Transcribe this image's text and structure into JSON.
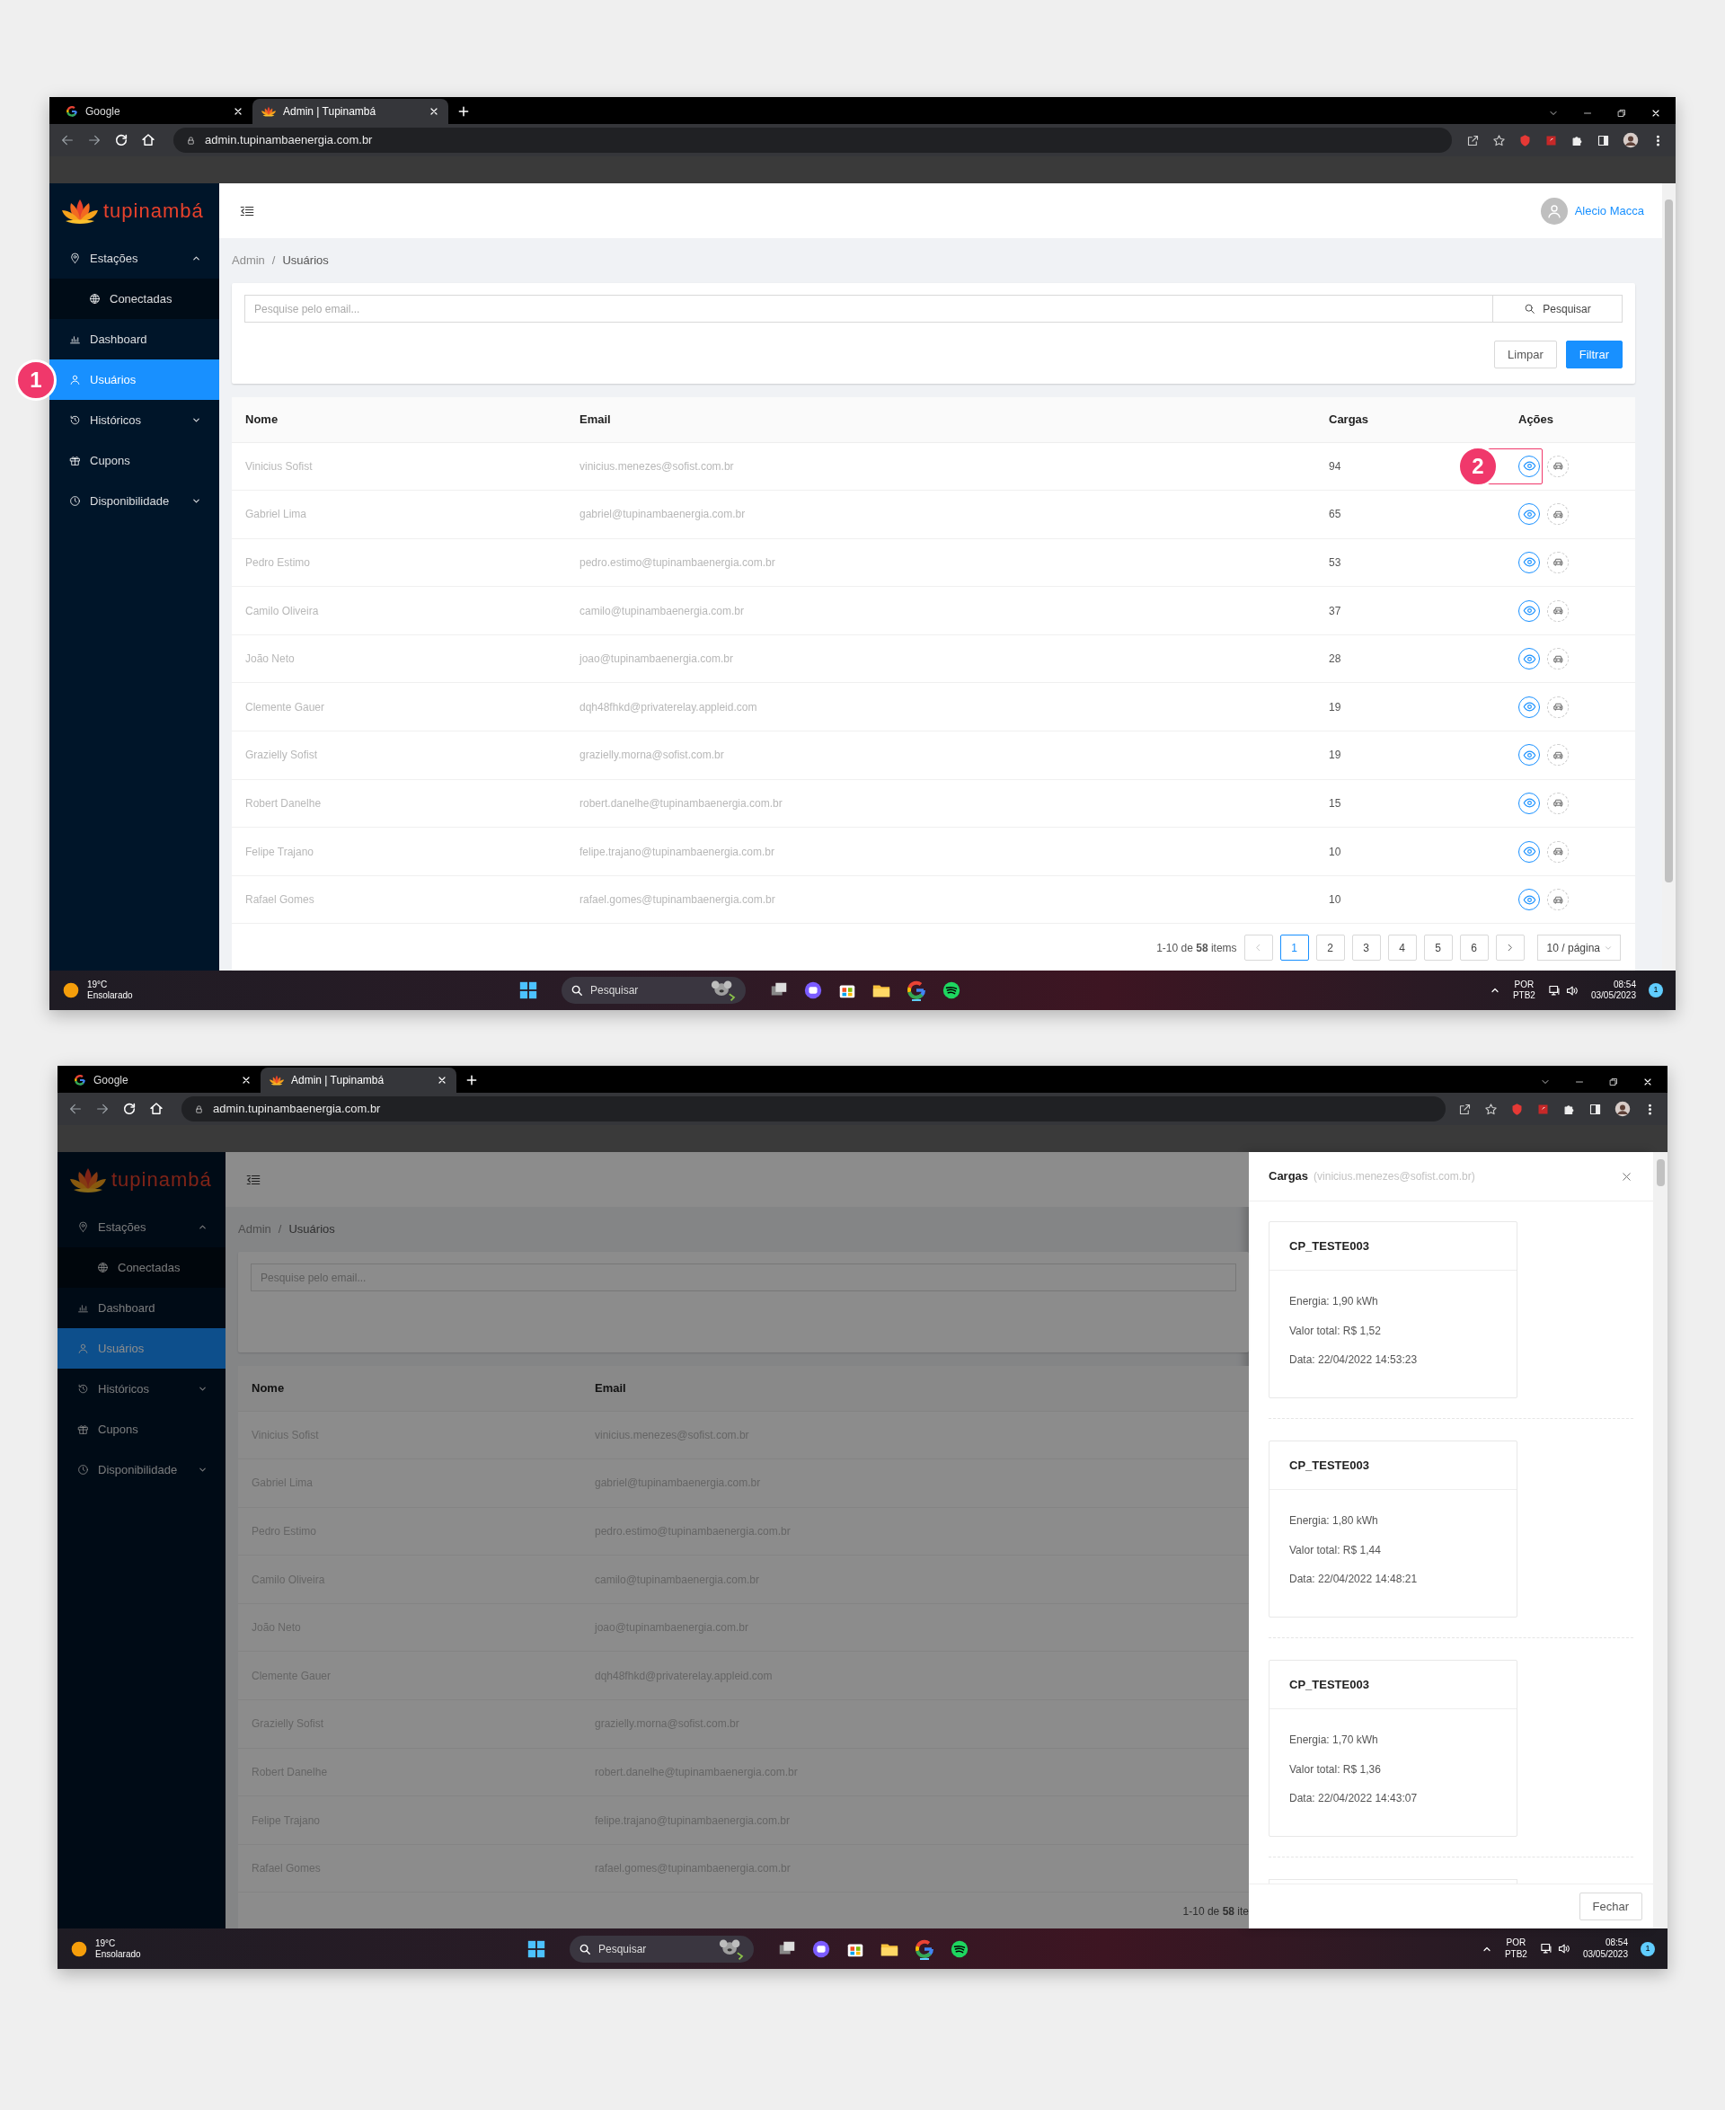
{
  "windows": [
    {
      "browser": {
        "tabs": [
          {
            "title": "Google",
            "selected": false
          },
          {
            "title": "Admin | Tupinambá",
            "selected": true
          }
        ],
        "url": "admin.tupinambaenergia.com.br"
      },
      "app": {
        "logo": "tupinambá",
        "sidebar": [
          {
            "label": "Estações",
            "expanded": true,
            "selected": false,
            "children": [
              {
                "label": "Conectadas",
                "selected": false
              }
            ]
          },
          {
            "label": "Dashboard",
            "selected": false
          },
          {
            "label": "Usuários",
            "selected": true
          },
          {
            "label": "Históricos",
            "expanded": false,
            "selected": false
          },
          {
            "label": "Cupons",
            "selected": false
          },
          {
            "label": "Disponibilidade",
            "expanded": false,
            "selected": false
          }
        ],
        "user_name": "Alecio Macca",
        "breadcrumb": {
          "items": [
            "Admin",
            "Usuários"
          ],
          "separator": "/"
        },
        "search": {
          "placeholder": "Pesquise pelo email...",
          "button": "Pesquisar"
        },
        "filter_buttons": [
          {
            "label": "Limpar",
            "kind": "default"
          },
          {
            "label": "Filtrar",
            "kind": "primary"
          }
        ],
        "table": {
          "columns": [
            "Nome",
            "Email",
            "Cargas",
            "Ações"
          ],
          "rows": [
            [
              "Vinicius Sofist",
              "vinicius.menezes@sofist.com.br",
              "94"
            ],
            [
              "Gabriel Lima",
              "gabriel@tupinambaenergia.com.br",
              "65"
            ],
            [
              "Pedro Estimo",
              "pedro.estimo@tupinambaenergia.com.br",
              "53"
            ],
            [
              "Camilo Oliveira",
              "camilo@tupinambaenergia.com.br",
              "37"
            ],
            [
              "João Neto",
              "joao@tupinambaenergia.com.br",
              "28"
            ],
            [
              "Clemente Gauer",
              "dqh48fhkd@privaterelay.appleid.com",
              "19"
            ],
            [
              "Grazielly Sofist",
              "grazielly.morna@sofist.com.br",
              "19"
            ],
            [
              "Robert Danelhe",
              "robert.danelhe@tupinambaenergia.com.br",
              "15"
            ],
            [
              "Felipe Trajano",
              "felipe.trajano@tupinambaenergia.com.br",
              "10"
            ],
            [
              "Rafael Gomes",
              "rafael.gomes@tupinambaenergia.com.br",
              "10"
            ]
          ]
        },
        "pagination": {
          "summary": "1-10 de **58** items",
          "pages": [
            {
              "label": "1",
              "selected": true
            },
            {
              "label": "2",
              "selected": false
            },
            {
              "label": "3",
              "selected": false
            },
            {
              "label": "4",
              "selected": false
            },
            {
              "label": "5",
              "selected": false
            },
            {
              "label": "6",
              "selected": false
            }
          ],
          "page_size": "10 / página"
        }
      },
      "annotations": [
        {
          "label": "1",
          "kind": "menu"
        },
        {
          "label": "2",
          "kind": "action"
        }
      ],
      "taskbar": {
        "temperature": "19°C",
        "weather": "Ensolarado",
        "search": "Pesquisar",
        "language": "POR",
        "layout": "PTB2",
        "time": "08:54",
        "date": "03/05/2023",
        "notifications": "1"
      }
    },
    {
      "browser": {
        "tabs": [
          {
            "title": "Google",
            "selected": false
          },
          {
            "title": "Admin | Tupinambá",
            "selected": true
          }
        ],
        "url": "admin.tupinambaenergia.com.br"
      },
      "app": {
        "logo": "tupinambá",
        "sidebar": [
          {
            "label": "Estações",
            "expanded": true,
            "selected": false,
            "children": [
              {
                "label": "Conectadas",
                "selected": false
              }
            ]
          },
          {
            "label": "Dashboard",
            "selected": false
          },
          {
            "label": "Usuários",
            "selected": true
          },
          {
            "label": "Históricos",
            "expanded": false,
            "selected": false
          },
          {
            "label": "Cupons",
            "selected": false
          },
          {
            "label": "Disponibilidade",
            "expanded": false,
            "selected": false
          }
        ],
        "breadcrumb": {
          "items": [
            "Admin",
            "Usuários"
          ],
          "separator": "/"
        },
        "search": {
          "placeholder": "Pesquise pelo email..."
        },
        "table": {
          "columns": [
            "Nome",
            "Email"
          ],
          "rows": [
            [
              "Vinicius Sofist",
              "vinicius.menezes@sofist.com.br"
            ],
            [
              "Gabriel Lima",
              "gabriel@tupinambaenergia.com.br"
            ],
            [
              "Pedro Estimo",
              "pedro.estimo@tupinambaenergia.com.br"
            ],
            [
              "Camilo Oliveira",
              "camilo@tupinambaenergia.com.br"
            ],
            [
              "João Neto",
              "joao@tupinambaenergia.com.br"
            ],
            [
              "Clemente Gauer",
              "dqh48fhkd@privaterelay.appleid.com"
            ],
            [
              "Grazielly Sofist",
              "grazielly.morna@sofist.com.br"
            ],
            [
              "Robert Danelhe",
              "robert.danelhe@tupinambaenergia.com.br"
            ],
            [
              "Felipe Trajano",
              "felipe.trajano@tupinambaenergia.com.br"
            ],
            [
              "Rafael Gomes",
              "rafael.gomes@tupinambaenergia.com.br"
            ]
          ]
        },
        "pagination": {
          "summary": "1-10 de **58** ite"
        },
        "drawer": {
          "title": "Cargas",
          "subtitle": "(vinicius.menezes@sofist.com.br)",
          "more_below": true,
          "button": "Fechar",
          "cards": [
            {
              "title": "CP_TESTE003",
              "lines": [
                "Energia: 1,90 kWh",
                "Valor total: R$ 1,52",
                "Data: 22/04/2022 14:53:23"
              ]
            },
            {
              "title": "CP_TESTE003",
              "lines": [
                "Energia: 1,80 kWh",
                "Valor total: R$ 1,44",
                "Data: 22/04/2022 14:48:21"
              ]
            },
            {
              "title": "CP_TESTE003",
              "lines": [
                "Energia: 1,70 kWh",
                "Valor total: R$ 1,36",
                "Data: 22/04/2022 14:43:07"
              ]
            }
          ]
        }
      },
      "taskbar": {
        "temperature": "19°C",
        "weather": "Ensolarado",
        "search": "Pesquisar",
        "language": "POR",
        "layout": "PTB2",
        "time": "08:54",
        "date": "03/05/2023",
        "notifications": "1"
      }
    }
  ]
}
